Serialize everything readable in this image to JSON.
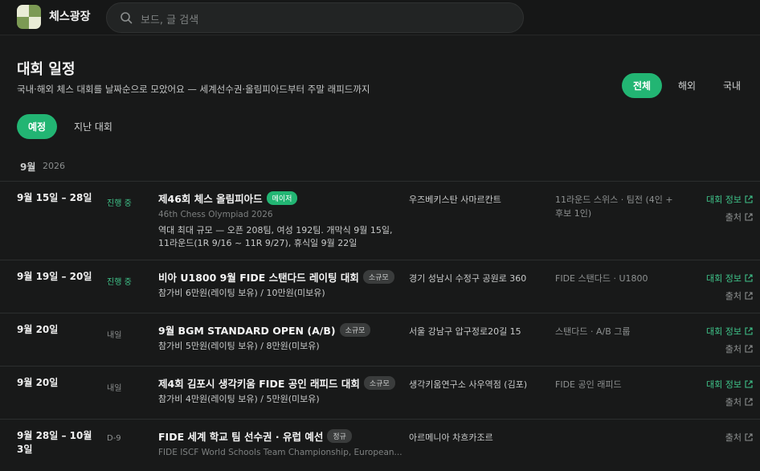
{
  "app": {
    "name": "체스광장"
  },
  "search": {
    "placeholder": "보드, 글 검색"
  },
  "header": {
    "title": "대회 일정",
    "subtitle": "국내·해외 체스 대회를 날짜순으로 모았어요 — 세계선수권·올림피아드부터 주말 래피드까지"
  },
  "region_filters": [
    {
      "label": "전체",
      "active": true
    },
    {
      "label": "해외",
      "active": false
    },
    {
      "label": "국내",
      "active": false
    }
  ],
  "tabs": [
    {
      "label": "예정",
      "active": true
    },
    {
      "label": "지난 대회",
      "active": false
    }
  ],
  "month_group": {
    "month": "9월",
    "year": "2026"
  },
  "link_labels": {
    "info": "대회 정보",
    "source": "출처"
  },
  "events": [
    {
      "date_lines": [
        "9월 15일 – 28일"
      ],
      "status": "진행 중",
      "status_live": true,
      "title": "제46회 체스 올림피아드",
      "badge": "메이저",
      "badge_type": "major",
      "english": "46th Chess Olympiad 2026",
      "description_lines": [
        "역대 최대 규모 — 오픈 208팀, 여성 192팀. 개막식 9월 15일,",
        "11라운드(1R 9/16 ~ 11R 9/27), 휴식일 9월 22일"
      ],
      "location": "우즈베키스탄 사마르칸트",
      "format_lines": [
        "11라운드 스위스 · 팀전 (4인 +",
        "후보 1인)"
      ],
      "has_info": true
    },
    {
      "date_lines": [
        "9월 19일 – 20일"
      ],
      "status": "진행 중",
      "status_live": true,
      "title": "비아 U1800 9월 FIDE 스탠다드 레이팅 대회",
      "badge": "소규모",
      "badge_type": "small",
      "english": "",
      "description_lines": [
        "참가비 6만원(레이팅 보유) / 10만원(미보유)"
      ],
      "location": "경기 성남시 수정구 공원로 360",
      "format_lines": [
        "FIDE 스탠다드 · U1800"
      ],
      "has_info": true
    },
    {
      "date_lines": [
        "9월 20일"
      ],
      "status": "내일",
      "status_live": false,
      "title": "9월 BGM STANDARD OPEN (A/B)",
      "badge": "소규모",
      "badge_type": "small",
      "english": "",
      "description_lines": [
        "참가비 5만원(레이팅 보유) / 8만원(미보유)"
      ],
      "location": "서울 강남구 압구정로20길 15",
      "format_lines": [
        "스탠다드 · A/B 그룹"
      ],
      "has_info": true
    },
    {
      "date_lines": [
        "9월 20일"
      ],
      "status": "내일",
      "status_live": false,
      "title": "제4회 김포시 생각키움 FIDE 공인 래피드 대회",
      "badge": "소규모",
      "badge_type": "small",
      "english": "",
      "description_lines": [
        "참가비 4만원(레이팅 보유) / 5만원(미보유)"
      ],
      "location": "생각키움연구소 사우역점 (김포)",
      "format_lines": [
        "FIDE 공인 래피드"
      ],
      "has_info": true
    },
    {
      "date_lines": [
        "9월 28일 – 10월",
        "3일"
      ],
      "status": "D-9",
      "status_live": false,
      "title": "FIDE 세계 학교 팀 선수권 · 유럽 예선",
      "badge": "정규",
      "badge_type": "small",
      "english": "FIDE ISCF World Schools Team Championship, European...",
      "description_lines": [],
      "location": "아르메니아 차흐카조르",
      "format_lines": [],
      "has_info": false
    }
  ],
  "colors": {
    "accent": "#22b573",
    "background": "#181919"
  }
}
